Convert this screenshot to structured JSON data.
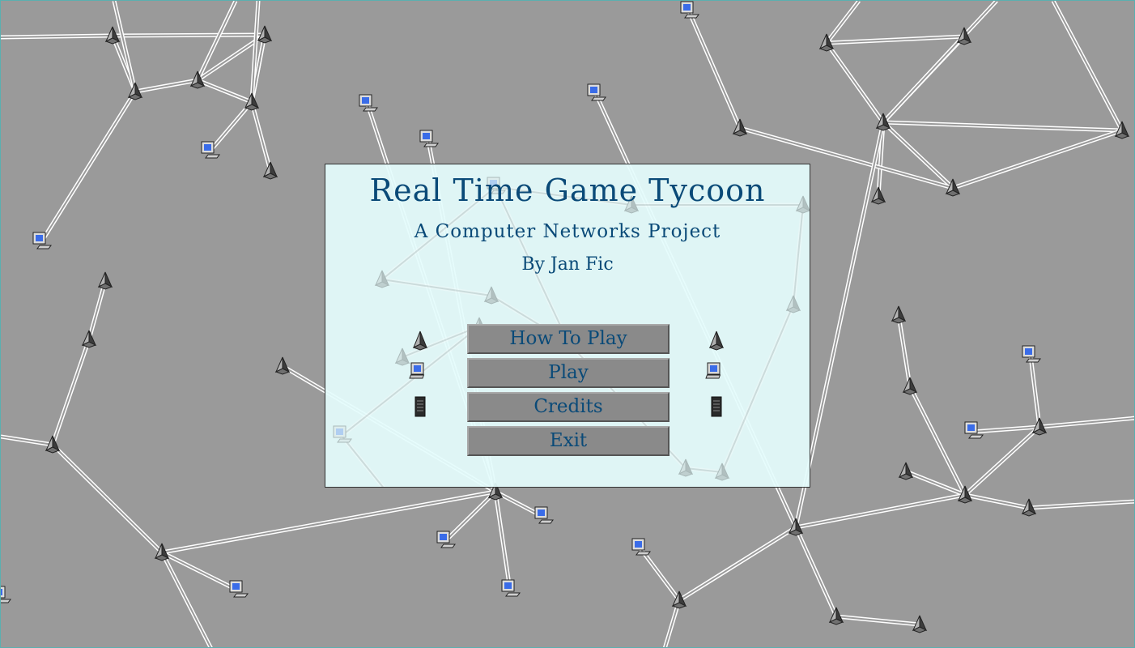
{
  "title": "Real Time Game Tycoon",
  "subtitle": "A  Computer Networks Project",
  "author": "By Jan Fic",
  "menu": {
    "how_to_play": "How To Play",
    "play": "Play",
    "credits": "Credits",
    "exit": "Exit"
  },
  "icons": {
    "router": "router-icon",
    "computer": "computer-icon",
    "server": "server-icon"
  },
  "colors": {
    "background": "#9a9a9a",
    "panel": "#e4fcfc",
    "text": "#0a4a78",
    "button": "#8a8a8a",
    "link": "#ffffff"
  }
}
